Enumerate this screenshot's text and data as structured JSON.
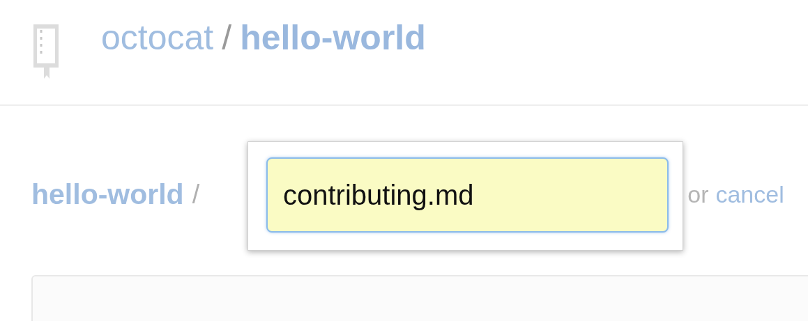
{
  "header": {
    "owner": "octocat",
    "separator": "/",
    "repo": "hello-world"
  },
  "path_bar": {
    "repo": "hello-world",
    "separator": "/",
    "filename_field": {
      "value": "contributing.md"
    },
    "or_text": "or",
    "cancel_link": "cancel"
  }
}
